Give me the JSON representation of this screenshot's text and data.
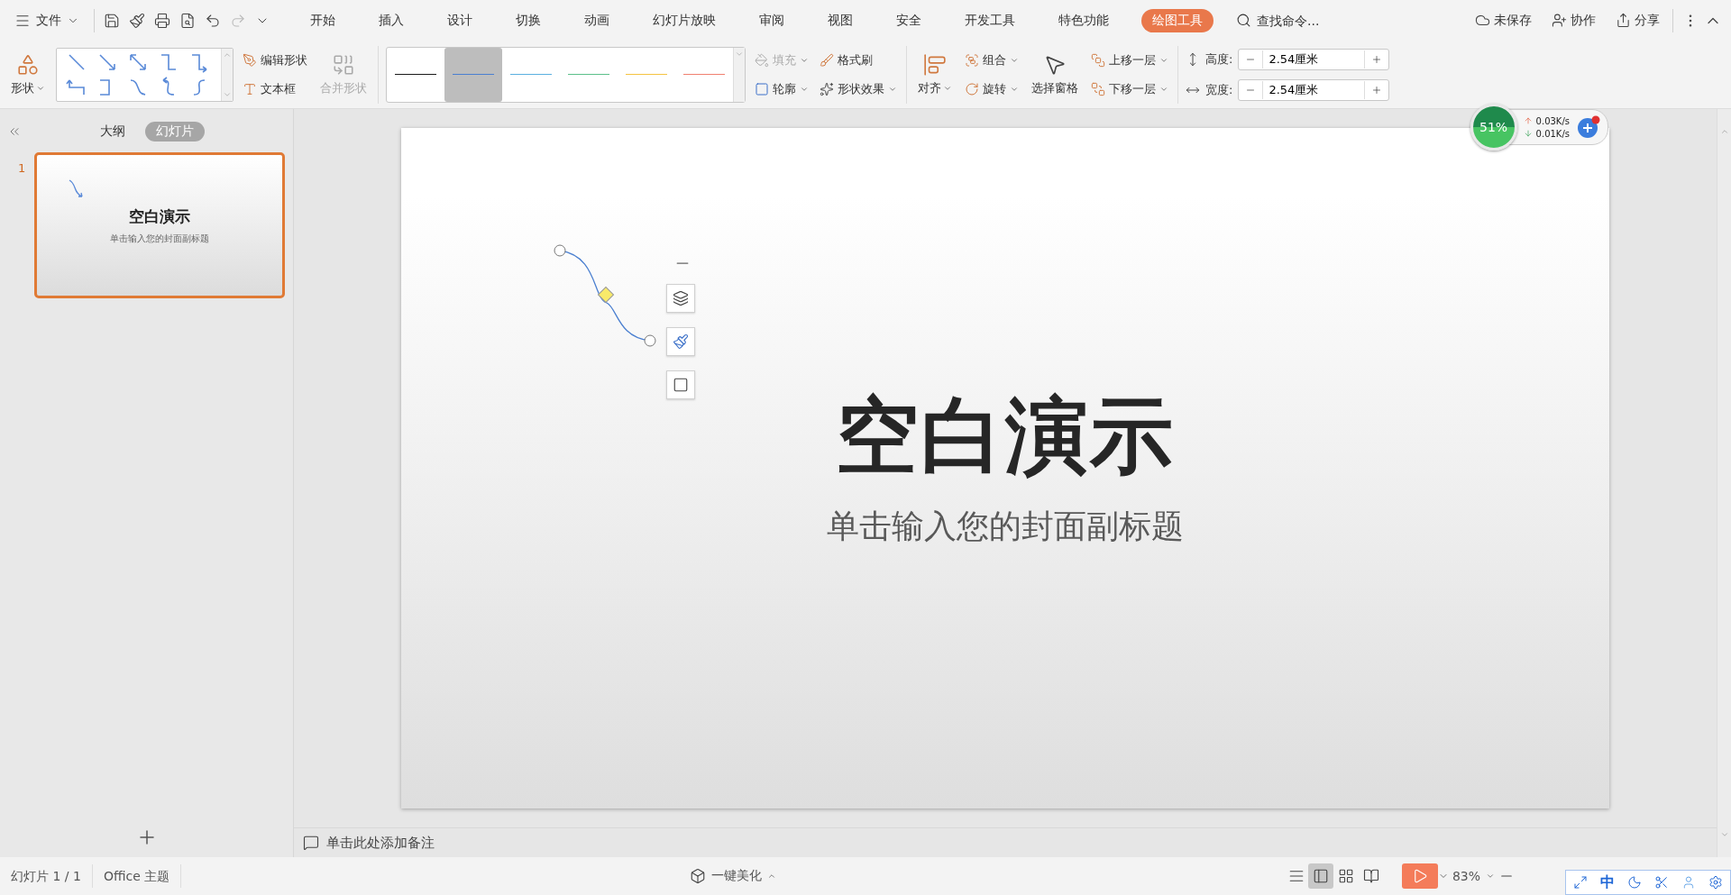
{
  "menu_button": {
    "label": "文件"
  },
  "menu_tabs": [
    {
      "label": "开始",
      "selected": false
    },
    {
      "label": "插入",
      "selected": false
    },
    {
      "label": "设计",
      "selected": false
    },
    {
      "label": "切换",
      "selected": false
    },
    {
      "label": "动画",
      "selected": false
    },
    {
      "label": "幻灯片放映",
      "selected": false
    },
    {
      "label": "审阅",
      "selected": false
    },
    {
      "label": "视图",
      "selected": false
    },
    {
      "label": "安全",
      "selected": false
    },
    {
      "label": "开发工具",
      "selected": false
    },
    {
      "label": "特色功能",
      "selected": false
    },
    {
      "label": "绘图工具",
      "selected": true
    }
  ],
  "search": {
    "placeholder": "查找命令..."
  },
  "top_actions": [
    {
      "kind": "cloud",
      "label": "未保存"
    },
    {
      "kind": "collab",
      "label": "协作"
    },
    {
      "kind": "share",
      "label": "分享"
    }
  ],
  "ribbon": {
    "shape_button": {
      "label": "形状"
    },
    "edit_shape": {
      "label": "编辑形状"
    },
    "text_box": {
      "label": "文本框"
    },
    "merge_shapes": {
      "label": "合并形状",
      "disabled": true
    },
    "line_styles": [
      {
        "color": "#1a1a1a",
        "selected": false
      },
      {
        "color": "#4a7fd0",
        "selected": true
      },
      {
        "color": "#5bb0e0",
        "selected": false
      },
      {
        "color": "#5cc08a",
        "selected": false
      },
      {
        "color": "#f5c342",
        "selected": false
      },
      {
        "color": "#f08070",
        "selected": false
      }
    ],
    "fill": {
      "label": "填充",
      "disabled": true
    },
    "format_painter": {
      "label": "格式刷",
      "disabled": false
    },
    "outline": {
      "label": "轮廓"
    },
    "shape_effects": {
      "label": "形状效果"
    },
    "align": {
      "label": "对齐"
    },
    "group": {
      "label": "组合"
    },
    "rotate": {
      "label": "旋转"
    },
    "selection_pane": {
      "label": "选择窗格"
    },
    "bring_forward": {
      "label": "上移一层"
    },
    "send_backward": {
      "label": "下移一层"
    },
    "size_fields": [
      {
        "kind": "height",
        "label": "高度:",
        "value": "2.54厘米"
      },
      {
        "kind": "width",
        "label": "宽度:",
        "value": "2.54厘米"
      }
    ]
  },
  "view_tabs": [
    {
      "label": "大纲",
      "selected": false
    },
    {
      "label": "幻灯片",
      "selected": true
    }
  ],
  "slides": [
    {
      "number": "1",
      "title": "空白演示",
      "subtitle": "单击输入您的封面副标题",
      "selected": true
    }
  ],
  "slide": {
    "title": "空白演示",
    "subtitle": "单击输入您的封面副标题"
  },
  "notes": {
    "prompt": "单击此处添加备注"
  },
  "network_widget": {
    "percent": "51%",
    "upload": "0.03K/s",
    "download": "0.01K/s"
  },
  "status_bar": {
    "slide_counter": "幻灯片 1 / 1",
    "theme": "Office 主题",
    "beautify": "一键美化",
    "view_modes": [
      {
        "kind": "normal",
        "selected": true
      },
      {
        "kind": "sorter",
        "selected": false
      },
      {
        "kind": "reading",
        "selected": false
      }
    ],
    "zoom": "83%"
  },
  "ime": {
    "mode": "中"
  }
}
